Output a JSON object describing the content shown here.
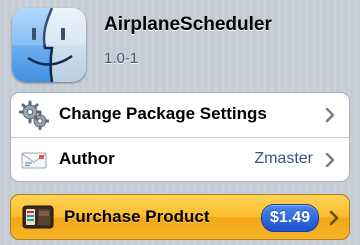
{
  "app": {
    "name": "AirplaneScheduler",
    "version": "1.0-1",
    "icon": "finder-face-icon"
  },
  "settings_group": {
    "rows": [
      {
        "label": "Change Package Settings",
        "value": "",
        "icon": "gears-icon"
      },
      {
        "label": "Author",
        "value": "Zmaster",
        "icon": "mail-icon"
      }
    ]
  },
  "purchase": {
    "label": "Purchase Product",
    "price": "$1.49",
    "icon": "wallet-icon"
  },
  "colors": {
    "background": "#c5ccd4",
    "purchase_accent": "#fbbd2c",
    "price_badge": "#2a62e0",
    "detail_text": "#385487"
  }
}
